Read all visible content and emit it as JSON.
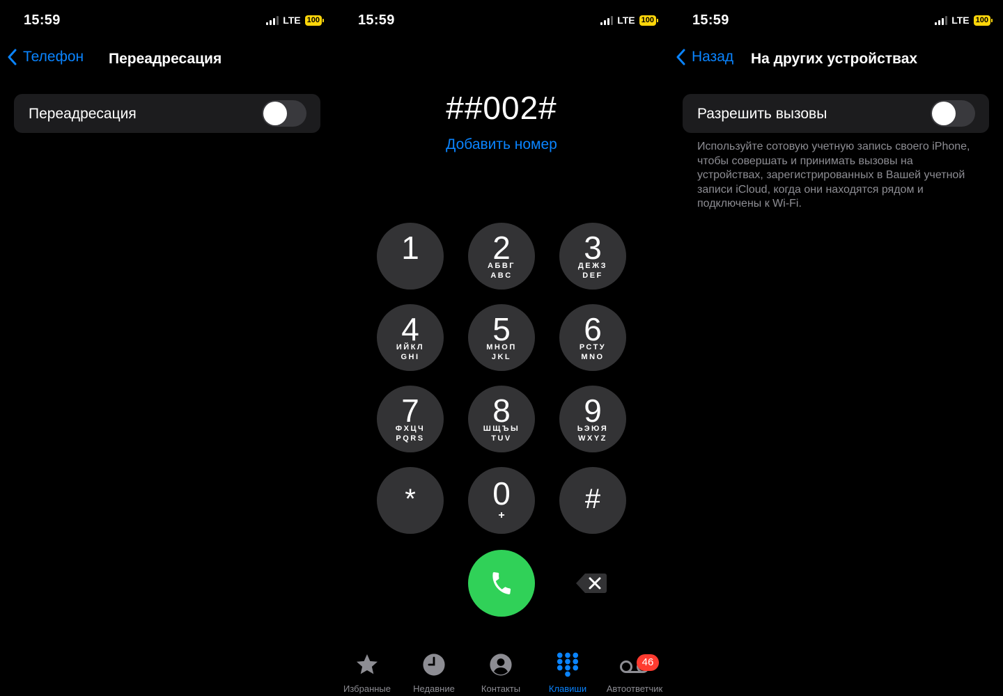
{
  "colors": {
    "accent": "#0a84ff",
    "call_green": "#30d158",
    "key_bg": "#333335",
    "row_bg": "#1c1c1e",
    "battery": "#ffd60a",
    "badge": "#ff3b30"
  },
  "status": {
    "time": "15:59",
    "network": "LTE",
    "battery": "100"
  },
  "screen1": {
    "back_label": "Телефон",
    "title": "Переадресация",
    "row_label": "Переадресация",
    "toggle_on": false
  },
  "screen2": {
    "number": "##002#",
    "add_number": "Добавить номер",
    "keys": [
      {
        "digit": "1",
        "l1": "",
        "l2": ""
      },
      {
        "digit": "2",
        "l1": "АБВГ",
        "l2": "ABC"
      },
      {
        "digit": "3",
        "l1": "ДЕЖЗ",
        "l2": "DEF"
      },
      {
        "digit": "4",
        "l1": "ИЙКЛ",
        "l2": "GHI"
      },
      {
        "digit": "5",
        "l1": "МНОП",
        "l2": "JKL"
      },
      {
        "digit": "6",
        "l1": "РСТУ",
        "l2": "MNO"
      },
      {
        "digit": "7",
        "l1": "ФХЦЧ",
        "l2": "PQRS"
      },
      {
        "digit": "8",
        "l1": "ШЩЪЫ",
        "l2": "TUV"
      },
      {
        "digit": "9",
        "l1": "ЬЭЮЯ",
        "l2": "WXYZ"
      },
      {
        "digit": "*",
        "l1": "",
        "l2": ""
      },
      {
        "digit": "0",
        "l1": "+",
        "l2": ""
      },
      {
        "digit": "#",
        "l1": "",
        "l2": ""
      }
    ],
    "call_icon": "phone-icon",
    "delete_icon": "backspace-icon",
    "tabs": [
      {
        "label": "Избранные",
        "icon": "star-icon"
      },
      {
        "label": "Недавние",
        "icon": "clock-icon"
      },
      {
        "label": "Контакты",
        "icon": "person-icon"
      },
      {
        "label": "Клавиши",
        "icon": "keypad-icon",
        "active": true
      },
      {
        "label": "Автоответчик",
        "icon": "voicemail-icon",
        "badge": "46"
      }
    ]
  },
  "screen3": {
    "back_label": "Назад",
    "title": "На других устройствах",
    "row_label": "Разрешить вызовы",
    "toggle_on": false,
    "footnote": "Используйте сотовую учетную запись своего iPhone, чтобы совершать и принимать вызовы на устройствах, зарегистрированных в Вашей учетной записи iCloud, когда они находятся рядом и подключены к Wi-Fi."
  }
}
